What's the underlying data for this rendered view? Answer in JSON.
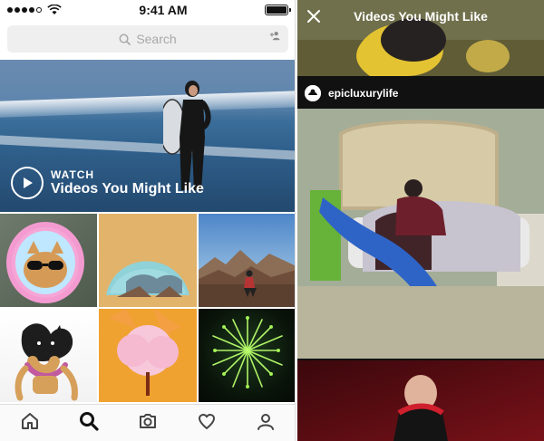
{
  "left_phone": {
    "status_bar": {
      "time": "9:41 AM",
      "signal_dots": [
        true,
        true,
        true,
        true,
        false
      ],
      "wifi_icon": "wifi-icon",
      "battery_icon": "battery-icon"
    },
    "search": {
      "placeholder": "Search",
      "search_icon": "search-icon",
      "add_user_icon": "add-user-icon"
    },
    "hero": {
      "watch_label": "WATCH",
      "title": "Videos You Might Like",
      "play_icon": "play-icon"
    },
    "tabs": [
      "home-icon",
      "search-icon",
      "camera-icon",
      "heart-icon",
      "profile-icon"
    ]
  },
  "right_phone": {
    "header": {
      "title": "Videos You Might Like",
      "close_icon": "close-icon"
    },
    "post": {
      "username": "epicluxurylife"
    }
  },
  "colors": {
    "search_bg": "#efefef",
    "placeholder": "#a8a8a8",
    "tabbar_bg": "#fafafa"
  }
}
